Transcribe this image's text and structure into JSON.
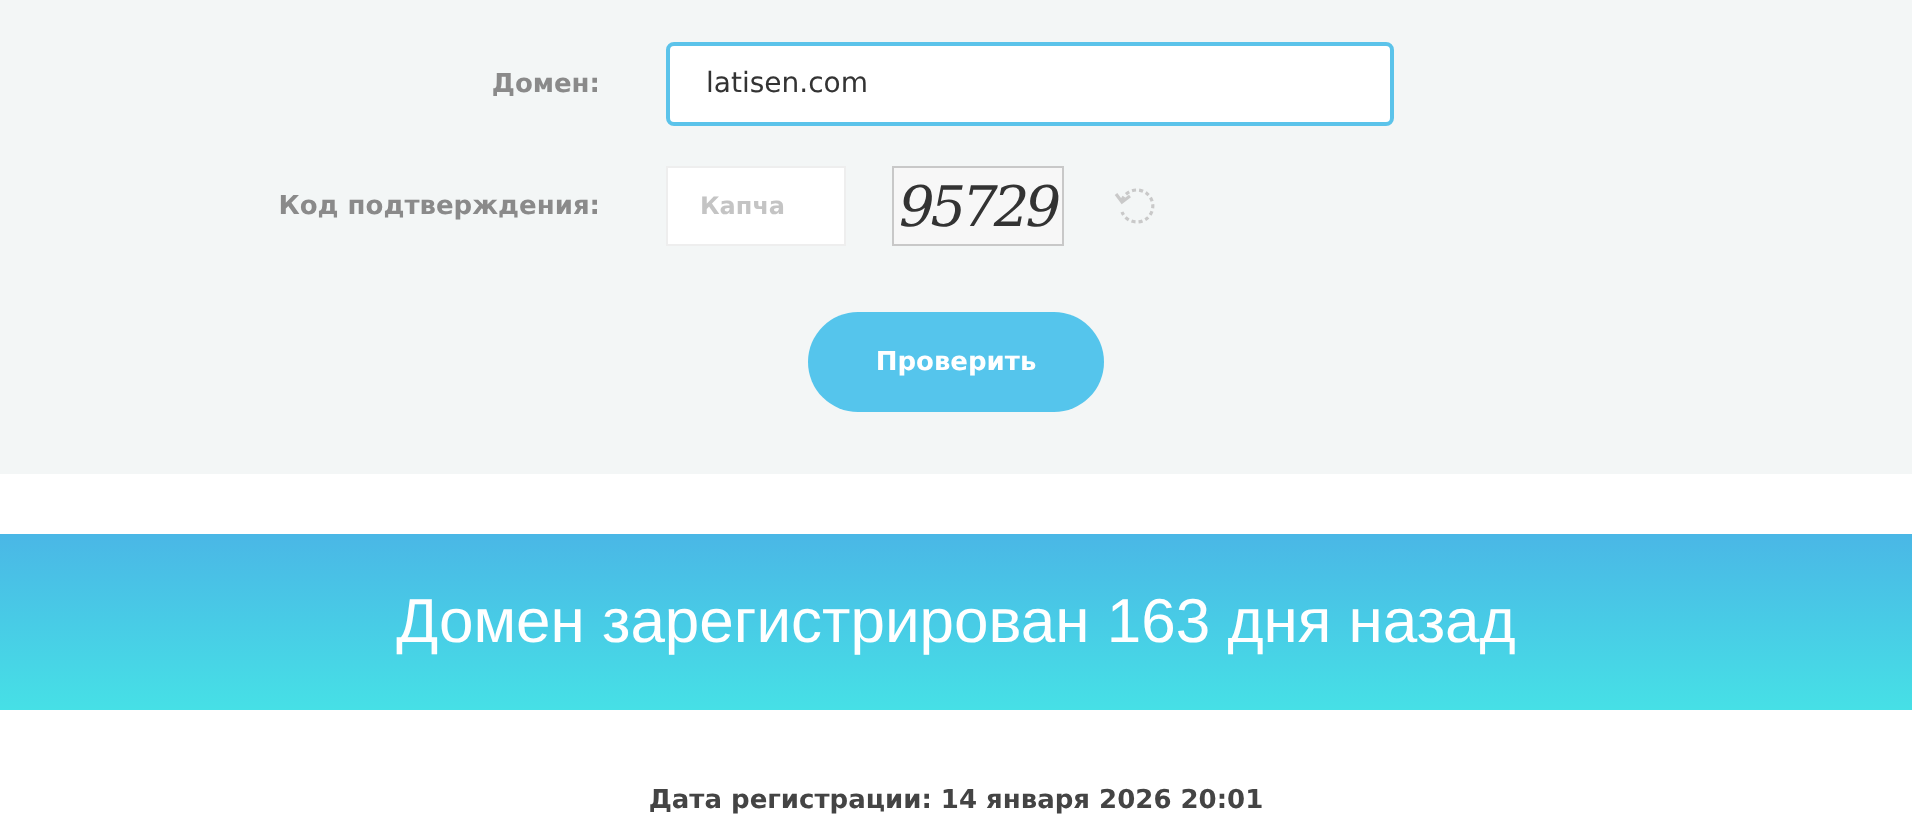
{
  "form": {
    "domain": {
      "label": "Домен:",
      "value": "latisen.com",
      "focused": true
    },
    "captcha": {
      "label": "Код подтверждения:",
      "placeholder": "Капча",
      "code": "95729"
    },
    "submit": "Проверить"
  },
  "result": {
    "headline": "Домен зарегистрирован 163 дня назад",
    "registration_date": "Дата регистрации: 14 января 2026 20:01"
  }
}
